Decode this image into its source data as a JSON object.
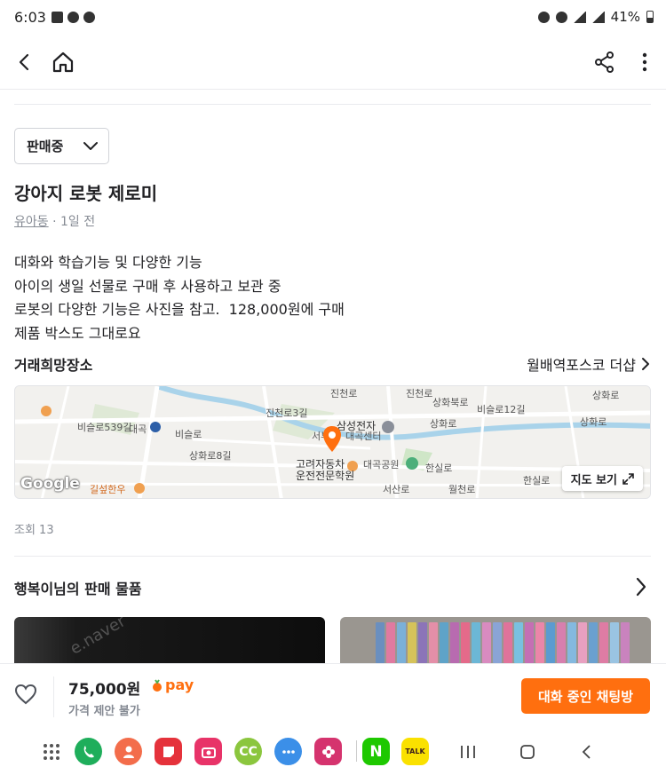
{
  "status_bar": {
    "time": "6:03",
    "battery": "41%"
  },
  "app_bar": {
    "back_icon": "chevron-left-icon",
    "home_icon": "home-icon",
    "share_icon": "share-icon",
    "more_icon": "more-vertical-icon"
  },
  "product": {
    "status_label": "판매중",
    "title": "강아지 로봇 제로미",
    "location": "유아동",
    "time_ago": " · 1일 전",
    "description": [
      "대화와 학습기능 및 다양한 기능",
      "아이의 생일 선물로 구매 후 사용하고 보관 중",
      "로봇의 다양한 기능은 사진을 참고.  128,000원에 구매",
      "제품 박스도 그대로요"
    ]
  },
  "place": {
    "label": "거래희망장소",
    "name": "월배역포스코 더샵",
    "map_button": "지도 보기",
    "map_labels": {
      "l1": "삼성전자",
      "l2": "대곡센터",
      "l3": "서부",
      "l4": "고려자동차",
      "l5": "운전전문학원",
      "l6": "대곡공원",
      "l7": "한실로",
      "l8": "서산로",
      "l9": "상화로",
      "l10": "상화로8길",
      "l11": "비슬로539길",
      "l12": "대곡",
      "l13": "비슬로",
      "l14": "진천로3길",
      "l15": "상화북로",
      "l16": "비슬로12길",
      "l17": "길섶한우",
      "l18": "한실로",
      "l19": "월천로",
      "l20": "상화로",
      "l21": "상화로",
      "l22": "진천로",
      "l23": "진천로"
    },
    "google": "Google"
  },
  "views": "조회 13",
  "seller_section": {
    "title": "행복이님의 판매 물품",
    "thumb1_watermark": "e.naver"
  },
  "bottom_bar": {
    "price": "75,000원",
    "pay_label": "pay",
    "price_note": "가격 제안 불가",
    "chat_button": "대화 중인 채팅방"
  },
  "taskbar": {
    "apps": [
      "phone",
      "contacts",
      "notes",
      "camera",
      "cc",
      "messages",
      "flower",
      "naver",
      "talk"
    ],
    "naver_label": "N",
    "talk_label": "TALK",
    "cc_label": "CC"
  },
  "colors": {
    "accent": "#ff6f0f",
    "text": "#212124",
    "muted": "#868b94"
  }
}
